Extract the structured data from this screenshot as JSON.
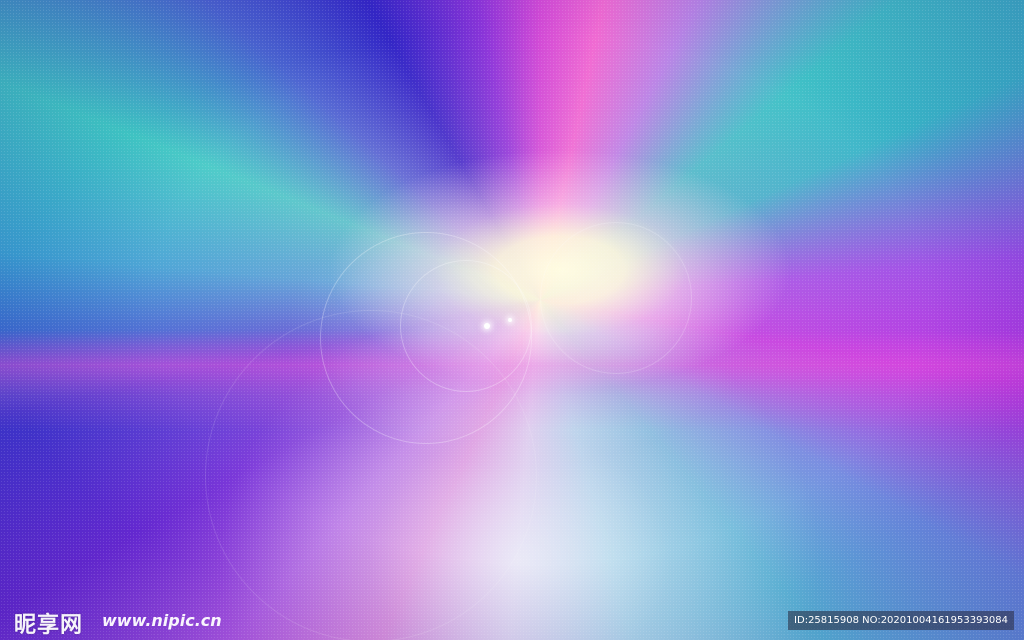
{
  "image": {
    "subject": "abstract radial light burst",
    "colors": {
      "blue": "#3b2fc6",
      "cyan": "#3fc3c7",
      "magenta": "#e86fd7",
      "purple": "#9a4be6",
      "highlight": "#fff8dc"
    }
  },
  "watermark": {
    "logo_text": "昵享网",
    "url_text": "www.nipic.cn",
    "id_text": "ID:25815908 NO:20201004161953393084"
  }
}
